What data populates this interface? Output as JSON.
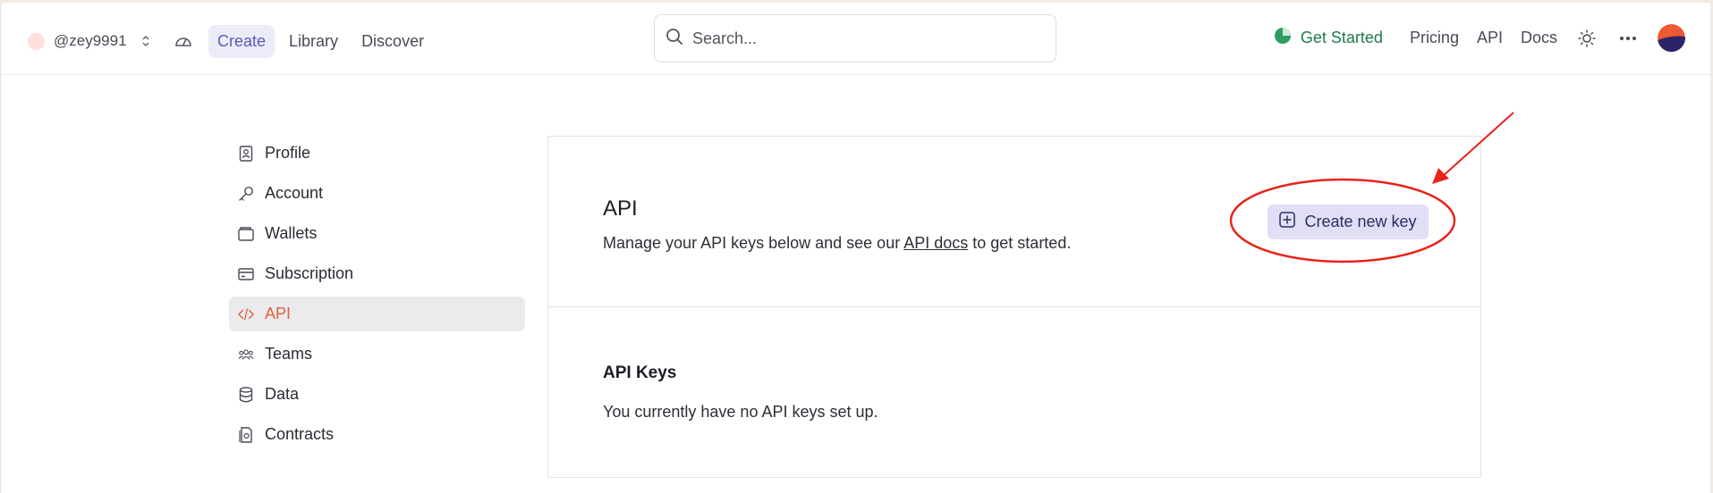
{
  "header": {
    "username": "@zey9991",
    "nav": [
      {
        "label": "Create",
        "active": true
      },
      {
        "label": "Library",
        "active": false
      },
      {
        "label": "Discover",
        "active": false
      }
    ],
    "search_placeholder": "Search...",
    "get_started": "Get Started",
    "right_links": [
      "Pricing",
      "API",
      "Docs"
    ],
    "icons": [
      "speedometer-icon",
      "search-icon",
      "progress-pie-icon",
      "sun-icon",
      "more-dots-icon"
    ]
  },
  "sidebar": {
    "items": [
      {
        "label": "Profile",
        "icon": "profile-icon",
        "active": false
      },
      {
        "label": "Account",
        "icon": "key-icon",
        "active": false
      },
      {
        "label": "Wallets",
        "icon": "wallet-icon",
        "active": false
      },
      {
        "label": "Subscription",
        "icon": "card-icon",
        "active": false
      },
      {
        "label": "API",
        "icon": "code-icon",
        "active": true
      },
      {
        "label": "Teams",
        "icon": "team-icon",
        "active": false
      },
      {
        "label": "Data",
        "icon": "database-icon",
        "active": false
      },
      {
        "label": "Contracts",
        "icon": "contract-icon",
        "active": false
      }
    ]
  },
  "main": {
    "title": "API",
    "description_before": "Manage your API keys below and see our ",
    "description_link": "API docs",
    "description_after": " to get started.",
    "create_button": "Create new key",
    "keys_title": "API Keys",
    "keys_empty": "You currently have no API keys set up."
  },
  "colors": {
    "accent": "#5b5bb5",
    "active_sidebar": "#e2603e",
    "get_started": "#1f7a4a",
    "annotation": "#e8231b"
  }
}
